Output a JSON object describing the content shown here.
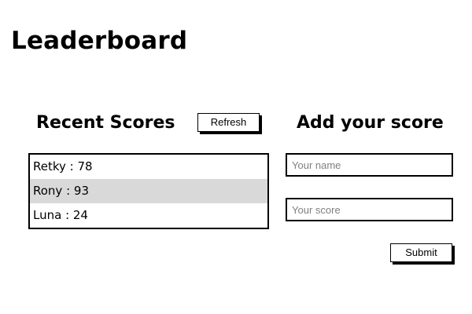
{
  "page": {
    "title": "Leaderboard"
  },
  "recent": {
    "heading": "Recent Scores",
    "refresh_label": "Refresh",
    "scores": [
      {
        "text": "Retky : 78"
      },
      {
        "text": "Rony : 93"
      },
      {
        "text": "Luna : 24"
      }
    ],
    "highlight_color": "#d9d9d9"
  },
  "add": {
    "heading": "Add your score",
    "name_placeholder": "Your name",
    "score_placeholder": "Your score",
    "submit_label": "Submit"
  }
}
